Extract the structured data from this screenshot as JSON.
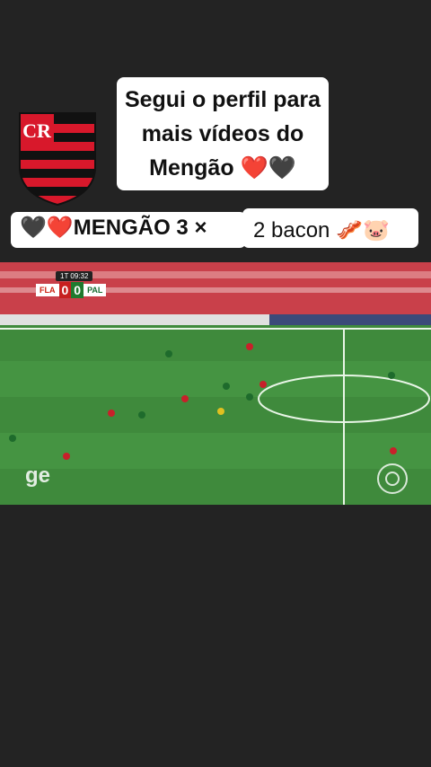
{
  "caption": {
    "line1": "Segui o perfil para",
    "line2": "mais vídeos do",
    "line3_text": "Mengão ",
    "line3_emoji_heart_red": "❤️",
    "line3_emoji_heart_black": "🖤"
  },
  "banner": {
    "left_text": "🖤❤️MENGÃO 3 ×",
    "right_text": "2 bacon 🥓🐷"
  },
  "video": {
    "clock": "1T 09:32",
    "home_team": "FLA",
    "home_score": "0",
    "away_score": "0",
    "away_team": "PAL",
    "broadcaster_logo": "ge",
    "network_icon": "globo-icon"
  },
  "colors": {
    "background": "#232323",
    "flamengo_red": "#d8182b",
    "pitch_green": "#3f8a3c"
  }
}
